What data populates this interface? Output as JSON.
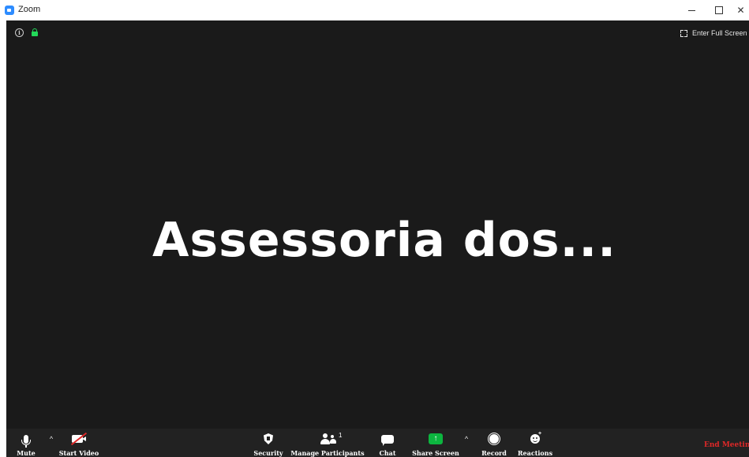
{
  "window": {
    "title": "Zoom",
    "minimize": "–",
    "close": "✕"
  },
  "meeting": {
    "fullscreen_label": "Enter Full Screen",
    "participant_display_name": "Assessoria  dos...",
    "info_glyph": "i"
  },
  "toolbar": {
    "mute_label": "Mute",
    "start_video_label": "Start Video",
    "security_label": "Security",
    "participants_label": "Manage Participants",
    "participants_count": "1",
    "chat_label": "Chat",
    "share_screen_label": "Share Screen",
    "share_glyph": "↑",
    "record_label": "Record",
    "reactions_label": "Reactions",
    "reactions_plus": "+",
    "end_meeting_label": "End Meeting",
    "caret": "^"
  },
  "colors": {
    "meeting_bg": "#1a1a1a",
    "toolbar_bg": "#222222",
    "share_green": "#0cb53f",
    "end_red": "#e02828",
    "lock_green": "#23d959",
    "zoom_blue": "#2d8cff"
  },
  "icons": [
    "zoom-app-icon",
    "info-icon",
    "lock-icon",
    "fullscreen-icon",
    "microphone-icon",
    "video-camera-off-icon",
    "shield-icon",
    "participants-icon",
    "chat-bubble-icon",
    "share-screen-icon",
    "record-icon",
    "reactions-icon",
    "chevron-up-icon"
  ]
}
